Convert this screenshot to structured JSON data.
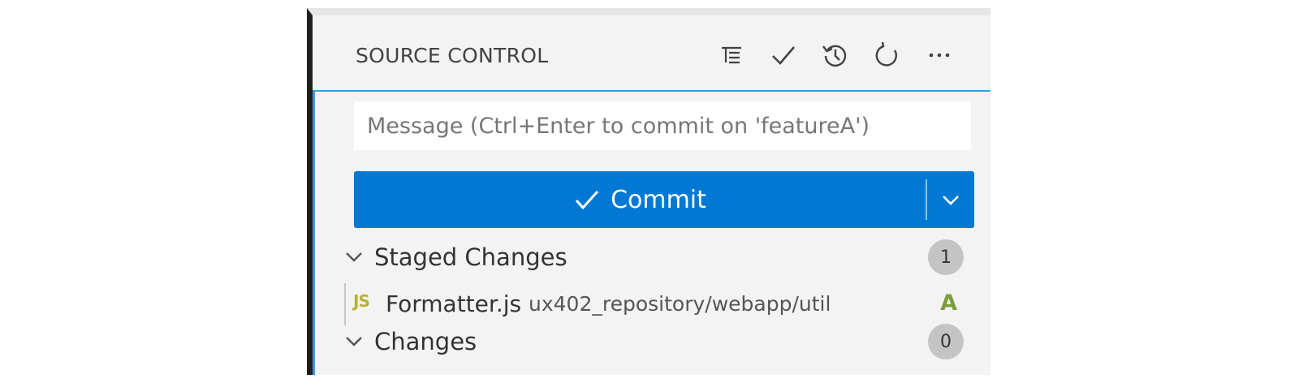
{
  "header": {
    "title": "SOURCE CONTROL",
    "actions": [
      {
        "icon": "view-as-tree-icon"
      },
      {
        "icon": "commit-check-icon"
      },
      {
        "icon": "history-icon"
      },
      {
        "icon": "refresh-icon"
      },
      {
        "icon": "more-actions-icon"
      }
    ]
  },
  "message": {
    "placeholder": "Message (Ctrl+Enter to commit on 'featureA')",
    "value": ""
  },
  "commit": {
    "label": "Commit",
    "icon": "check-icon",
    "dropdown_icon": "chevron-down-icon"
  },
  "sections": {
    "staged": {
      "label": "Staged Changes",
      "count": "1",
      "files": [
        {
          "icon": "JS",
          "name": "Formatter.js",
          "path": "ux402_repository/webapp/util",
          "status": "A"
        }
      ]
    },
    "changes": {
      "label": "Changes",
      "count": "0"
    }
  },
  "colors": {
    "accent": "#0078d4",
    "focus_border": "#3a9ad9",
    "added_status": "#7a9d3a",
    "js_icon": "#b5b13a",
    "panel_background": "#f3f3f3"
  }
}
